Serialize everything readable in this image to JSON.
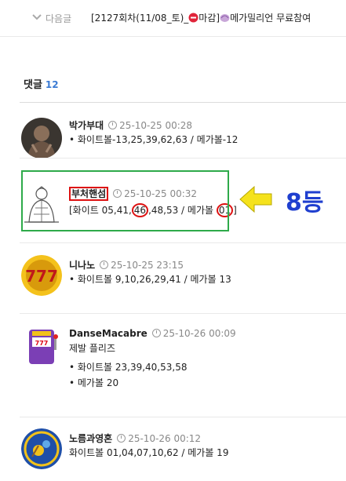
{
  "nav": {
    "next_label": "다음글",
    "next_title": "[2127회차(11/08_토)_",
    "next_title_mid": "마감]",
    "next_title_end": "메가밀리언 무료참여"
  },
  "comments_section": {
    "heading": "댓글",
    "count": "12"
  },
  "comments": [
    {
      "name": "박가부대",
      "time": "25-10-25 00:28",
      "lines": [
        "• 화이트볼-13,25,39,62,63 / 메가볼-12"
      ]
    },
    {
      "name": "부처핸섬",
      "time": "25-10-25 00:32",
      "line_a": "[화이트 05,41,",
      "hit1": "46",
      "line_b": ",48,53 / 메가볼 ",
      "hit2": "01",
      "line_c": "]"
    },
    {
      "name": "니나노",
      "time": "25-10-25 23:15",
      "lines": [
        "• 화이트볼 9,10,26,29,41 / 메가볼 13"
      ]
    },
    {
      "name": "DanseMacabre",
      "time": "25-10-26 00:09",
      "lines": [
        "제발 플리즈",
        "• 화이트볼 23,39,40,53,58",
        "• 메가볼 20"
      ]
    },
    {
      "name": "노름과영혼",
      "time": "25-10-26 00:12",
      "lines": [
        "화이트볼 01,04,07,10,62 / 메가볼 19"
      ]
    }
  ],
  "annotation": {
    "rank_label": "8등"
  },
  "colors": {
    "accent": "#3b7bd4",
    "highlight_border": "#2eaa4a",
    "circle": "#dd1111",
    "rank": "#1f3fcf",
    "arrow": "#f5e21c"
  }
}
